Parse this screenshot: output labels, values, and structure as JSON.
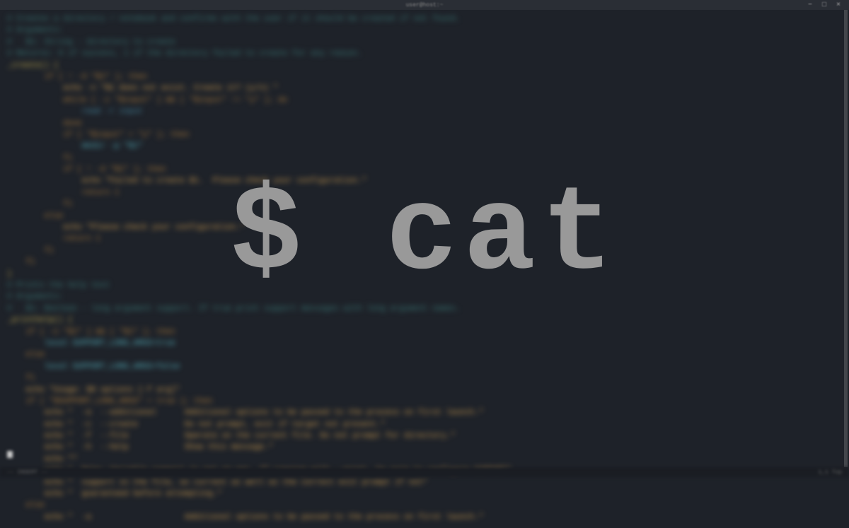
{
  "titlebar": {
    "title": "user@host:~"
  },
  "overlay": {
    "prompt": "$",
    "command": "cat"
  },
  "window_controls": {
    "minimize": "−",
    "maximize": "□",
    "close": "×"
  },
  "code_lines": [
    {
      "cls": "comment",
      "text": "# Creates a directory / notebook and confirms with the user if it should be created if not found."
    },
    {
      "cls": "plain",
      "text": ""
    },
    {
      "cls": "comment",
      "text": "# Arguments:"
    },
    {
      "cls": "comment",
      "text": "#   $1: String - directory to create"
    },
    {
      "cls": "plain",
      "text": ""
    },
    {
      "cls": "comment",
      "text": "# Returns: 0 if success, 1 if the directory failed to create for any reason."
    },
    {
      "cls": "func",
      "text": "_create() {"
    },
    {
      "cls": "keyword",
      "text": "        if [ ! -d \"$1\" ]; then"
    },
    {
      "cls": "string",
      "text": "            echo -n \"$1 does not exist. Create it? (y/n) \""
    },
    {
      "cls": "keyword",
      "text": "            while [ -z \"$input\" ] && [ \"$input\" != \"y\" ]; do"
    },
    {
      "cls": "var",
      "text": "                read -r input"
    },
    {
      "cls": "keyword",
      "text": "            done"
    },
    {
      "cls": "keyword",
      "text": "            if [ \"$input\" = \"y\" ]; then"
    },
    {
      "cls": "cyan",
      "text": "                mkdir -p \"$1\""
    },
    {
      "cls": "keyword",
      "text": "            fi"
    },
    {
      "cls": "keyword",
      "text": "            if [ ! -d \"$1\" ]; then"
    },
    {
      "cls": "string",
      "text": "                echo \"Failed to create $1.  Please check your configuration.\""
    },
    {
      "cls": "keyword",
      "text": "                return 1"
    },
    {
      "cls": "keyword",
      "text": "            fi"
    },
    {
      "cls": "keyword",
      "text": "        else"
    },
    {
      "cls": "string",
      "text": "            echo \"Please check your configuration.\""
    },
    {
      "cls": "keyword",
      "text": "            return 1"
    },
    {
      "cls": "keyword",
      "text": "        fi"
    },
    {
      "cls": "keyword",
      "text": "    fi"
    },
    {
      "cls": "func",
      "text": "}"
    },
    {
      "cls": "plain",
      "text": ""
    },
    {
      "cls": "comment",
      "text": "# Prints the help text"
    },
    {
      "cls": "plain",
      "text": ""
    },
    {
      "cls": "comment",
      "text": "# Arguments:"
    },
    {
      "cls": "comment",
      "text": "#   $1: Boolean - long argument support. If true print support messages with long argument names."
    },
    {
      "cls": "func",
      "text": "_printhelp() {"
    },
    {
      "cls": "keyword",
      "text": "    if [ -n \"$1\" ] && [ \"$1\" ]; then"
    },
    {
      "cls": "cyan",
      "text": "        local SUPPORT_LONG_ARGS=true"
    },
    {
      "cls": "keyword",
      "text": "    else"
    },
    {
      "cls": "cyan",
      "text": "        local SUPPORT_LONG_ARGS=false"
    },
    {
      "cls": "keyword",
      "text": "    fi"
    },
    {
      "cls": "plain",
      "text": ""
    },
    {
      "cls": "string",
      "text": "    echo \"Usage: $0 options [-f arg]\""
    },
    {
      "cls": "keyword",
      "text": "    if [ \"$SUPPORT_LONG_ARGS\" = true ]; then"
    },
    {
      "cls": "string",
      "text": "        echo \"  -a  --additional      Additional options to be passed to the process on first launch.\""
    },
    {
      "cls": "string",
      "text": "        echo \"  -c  --create          Do not prompt, exit if target not present.\""
    },
    {
      "cls": "string",
      "text": "        echo \"  -f  --file            Operate on the current file. Do not prompt for directory.\""
    },
    {
      "cls": "string",
      "text": "        echo \"  -h  --help            Show this message.\""
    },
    {
      "cls": "string",
      "text": "        echo \"\""
    },
    {
      "cls": "string",
      "text": "        echo \"  Note: Variable support is not on par. If running with --quiet, be sure to configure SUPPORT\""
    },
    {
      "cls": "string",
      "text": "        echo \"  support in the file, as current as well as the correct exit prompt if not\""
    },
    {
      "cls": "string",
      "text": "        echo \"  guaranteed before attempting.\""
    },
    {
      "cls": "keyword",
      "text": "    else"
    },
    {
      "cls": "string",
      "text": "        echo \"  -a                    Additional options to be passed to the process on first launch.\""
    }
  ],
  "statusbar": {
    "left": "-- INSERT --",
    "right": "1,1  Top"
  }
}
